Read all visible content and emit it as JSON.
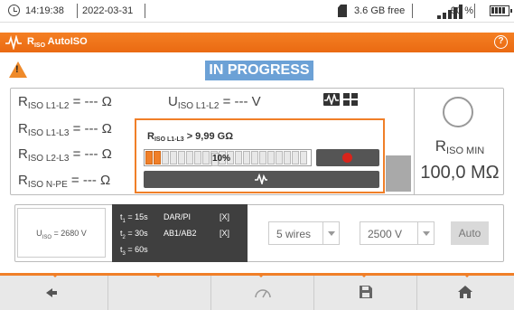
{
  "statusbar": {
    "time": "14:19:38",
    "date": "2022-03-31",
    "storage": "3.6 GB free",
    "battery": "90 %"
  },
  "titlebar": {
    "title_main": "R",
    "title_sub": "ISO",
    "title_rest": " AutoISO",
    "help": "?"
  },
  "warning": "!",
  "status": "IN PROGRESS",
  "results": {
    "r_l1l2": {
      "sym": "R",
      "sub": "ISO L1-L2",
      "val": " = --- Ω"
    },
    "r_l1l3": {
      "sym": "R",
      "sub": "ISO L1-L3",
      "val": " = --- Ω"
    },
    "r_l2l3": {
      "sym": "R",
      "sub": "ISO L2-L3",
      "val": " = --- Ω"
    },
    "r_npe": {
      "sym": "R",
      "sub": "ISO N-PE",
      "val": " = --- Ω"
    },
    "u_l1l2": {
      "sym": "U",
      "sub": "ISO L1-L2",
      "val": " = --- V"
    },
    "rmin_sym": "R",
    "rmin_sub": "ISO MIN",
    "rmin_value": "100,0 MΩ"
  },
  "popup": {
    "label_sym": "R",
    "label_sub": "ISO L1-L3",
    "label_val": " > 9,99 GΩ",
    "progress_text": "10%",
    "progress": 0.1
  },
  "settings": {
    "uiso_sym": "U",
    "uiso_sub": "ISO",
    "uiso_val": " = 2680 V",
    "t1": "15s",
    "t2": "30s",
    "t3": "60s",
    "dar_pi": "DAR/PI",
    "ab": "AB1/AB2",
    "x1": "[X]",
    "x2": "[X]",
    "wires": "5 wires",
    "voltage": "2500 V",
    "auto": "Auto"
  },
  "colors": {
    "accent": "#f07f28",
    "status_bg": "#6ca1d6"
  },
  "icons": [
    "clock-icon",
    "sd-card-icon",
    "signal-icon",
    "battery-icon",
    "wave-icon",
    "help-icon",
    "warning-icon",
    "graph-icon",
    "grid-icon",
    "stop-icon",
    "back-icon",
    "gauge-icon",
    "save-icon",
    "home-icon"
  ]
}
